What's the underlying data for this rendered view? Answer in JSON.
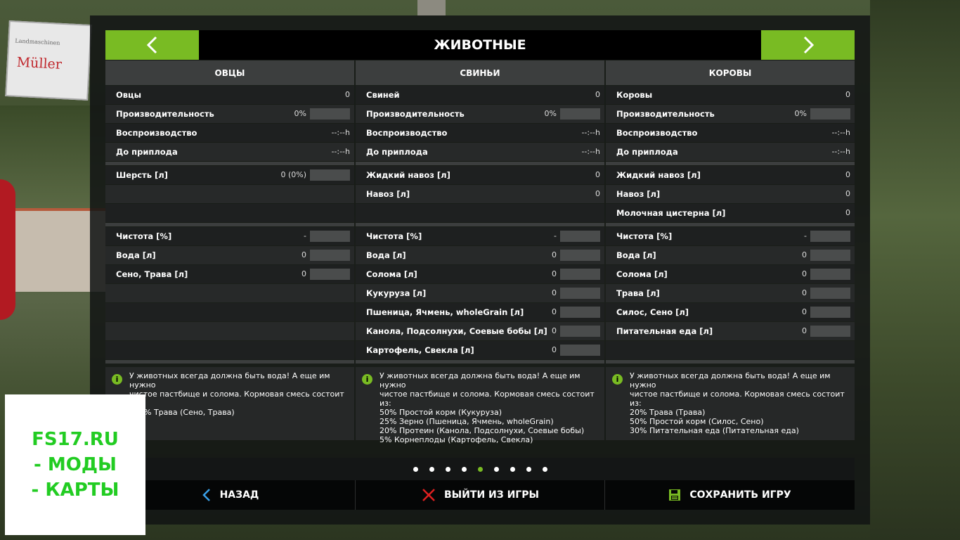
{
  "background": {
    "sign_small": "Landmaschinen",
    "sign_big": "Müller"
  },
  "header": {
    "title": "ЖИВОТНЫЕ",
    "prev_icon": "chevron-left-icon",
    "next_icon": "chevron-right-icon"
  },
  "colors": {
    "accent": "#79bb23",
    "watermark": "#22cc22"
  },
  "columns": [
    {
      "title": "ОВЦЫ",
      "stats": [
        {
          "label": "Овцы",
          "value": "0"
        },
        {
          "label": "Производительность",
          "value": "0%"
        },
        {
          "label": "Воспроизводство",
          "value": "--:--h"
        },
        {
          "label": "До приплода",
          "value": "--:--h"
        }
      ],
      "products": [
        {
          "label": "Шерсть [л]",
          "value": "0 (0%)"
        },
        {
          "label": "",
          "value": ""
        },
        {
          "label": "",
          "value": ""
        }
      ],
      "needs": [
        {
          "label": "Чистота [%]",
          "value": "-"
        },
        {
          "label": "Вода [л]",
          "value": "0"
        },
        {
          "label": "Сено, Трава [л]",
          "value": "0"
        },
        {
          "label": "",
          "value": ""
        },
        {
          "label": "",
          "value": ""
        },
        {
          "label": "",
          "value": ""
        },
        {
          "label": "",
          "value": ""
        }
      ],
      "info": "У животных всегда должна быть вода! А еще им нужно\nчистое пастбище и солома. Кормовая смесь состоит\nиз:\n100% Трава (Сено, Трава)"
    },
    {
      "title": "СВИНЬИ",
      "stats": [
        {
          "label": "Свиней",
          "value": "0"
        },
        {
          "label": "Производительность",
          "value": "0%"
        },
        {
          "label": "Воспроизводство",
          "value": "--:--h"
        },
        {
          "label": "До приплода",
          "value": "--:--h"
        }
      ],
      "products": [
        {
          "label": "Жидкий навоз [л]",
          "value": "0"
        },
        {
          "label": "Навоз [л]",
          "value": "0"
        },
        {
          "label": "",
          "value": ""
        }
      ],
      "needs": [
        {
          "label": "Чистота [%]",
          "value": "-"
        },
        {
          "label": "Вода [л]",
          "value": "0"
        },
        {
          "label": "Солома [л]",
          "value": "0"
        },
        {
          "label": "Кукуруза [л]",
          "value": "0"
        },
        {
          "label": "Пшеница, Ячмень, wholeGrain [л]",
          "value": "0"
        },
        {
          "label": "Канола, Подсолнухи, Соевые бобы [л]",
          "value": "0"
        },
        {
          "label": "Картофель, Свекла [л]",
          "value": "0"
        }
      ],
      "info": "У животных всегда должна быть вода! А еще им нужно\nчистое пастбище и солома. Кормовая смесь состоит\nиз:\n50% Простой корм (Кукуруза)\n25% Зерно (Пшеница, Ячмень, wholeGrain)\n20% Протеин (Канола, Подсолнухи, Соевые бобы)\n5% Корнеплоды (Картофель, Свекла)"
    },
    {
      "title": "КОРОВЫ",
      "stats": [
        {
          "label": "Коровы",
          "value": "0"
        },
        {
          "label": "Производительность",
          "value": "0%"
        },
        {
          "label": "Воспроизводство",
          "value": "--:--h"
        },
        {
          "label": "До приплода",
          "value": "--:--h"
        }
      ],
      "products": [
        {
          "label": "Жидкий навоз [л]",
          "value": "0"
        },
        {
          "label": "Навоз [л]",
          "value": "0"
        },
        {
          "label": "Молочная цистерна [л]",
          "value": "0"
        }
      ],
      "needs": [
        {
          "label": "Чистота [%]",
          "value": "-"
        },
        {
          "label": "Вода [л]",
          "value": "0"
        },
        {
          "label": "Солома [л]",
          "value": "0"
        },
        {
          "label": "Трава [л]",
          "value": "0"
        },
        {
          "label": "Силос, Сено [л]",
          "value": "0"
        },
        {
          "label": "Питательная еда [л]",
          "value": "0"
        },
        {
          "label": "",
          "value": ""
        }
      ],
      "info": "У животных всегда должна быть вода! А еще им нужно\nчистое пастбище и солома. Кормовая смесь состоит\nиз:\n20% Трава (Трава)\n50% Простой корм (Силос, Сено)\n30% Питательная еда (Питательная еда)"
    }
  ],
  "pager": {
    "count": 9,
    "active": 4
  },
  "footer": {
    "back": {
      "label": "НАЗАД",
      "icon": "chevron-left-icon"
    },
    "quit": {
      "label": "ВЫЙТИ ИЗ ИГРЫ",
      "icon": "close-icon"
    },
    "save": {
      "label": "СОХРАНИТЬ ИГРУ",
      "icon": "floppy-icon"
    }
  },
  "watermark": {
    "line1": "FS17.RU",
    "line2": "- МОДЫ",
    "line3": "- КАРТЫ"
  }
}
